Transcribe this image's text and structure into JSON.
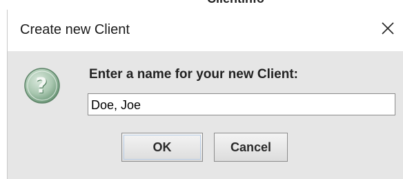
{
  "background_window": {
    "partial_title": "Clientinfo"
  },
  "dialog": {
    "title": "Create new Client",
    "close_icon": "close-icon",
    "prompt": "Enter a name for your new Client:",
    "input_value": "Doe, Joe",
    "ok_label": "OK",
    "cancel_label": "Cancel",
    "icon": "question-icon"
  },
  "colors": {
    "dialog_bg": "#e6e6e6",
    "titlebar_bg": "#ffffff",
    "icon_green": "#7fa888"
  }
}
